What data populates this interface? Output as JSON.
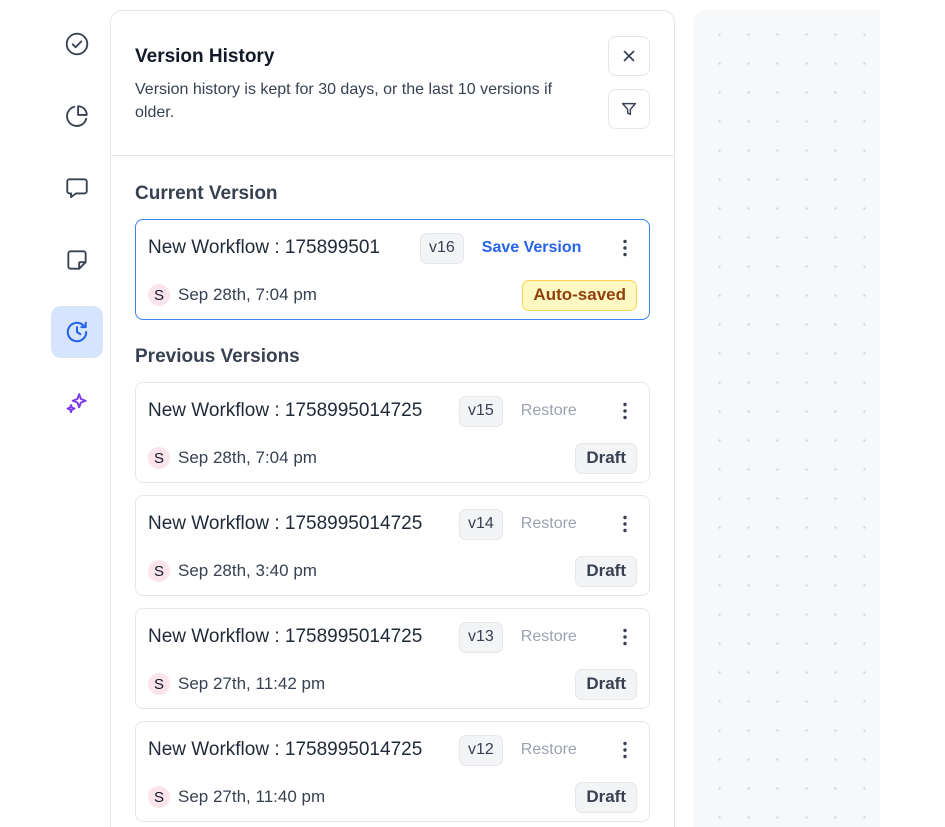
{
  "rail": {
    "items": [
      {
        "icon": "check-circle-icon",
        "active": false
      },
      {
        "icon": "pie-chart-icon",
        "active": false
      },
      {
        "icon": "comment-icon",
        "active": false
      },
      {
        "icon": "sticky-note-icon",
        "active": false
      },
      {
        "icon": "history-icon",
        "active": true
      },
      {
        "icon": "sparkles-icon",
        "active": false
      }
    ],
    "accent": "#3b82f6",
    "ai_color": "#7c3aed"
  },
  "panel": {
    "title": "Version History",
    "description": "Version history is kept for 30 days, or the last 10 versions if older.",
    "close_icon": "close-icon",
    "filter_icon": "filter-icon"
  },
  "current": {
    "heading": "Current Version",
    "card": {
      "name": "New Workflow : 175899501",
      "version": "v16",
      "action": "Save Version",
      "avatar": "S",
      "date": "Sep 28th, 7:04 pm",
      "status": "Auto-saved"
    }
  },
  "previous": {
    "heading": "Previous Versions",
    "cards": [
      {
        "name": "New Workflow : 1758995014725",
        "version": "v15",
        "action": "Restore",
        "avatar": "S",
        "date": "Sep 28th, 7:04 pm",
        "status": "Draft"
      },
      {
        "name": "New Workflow : 1758995014725",
        "version": "v14",
        "action": "Restore",
        "avatar": "S",
        "date": "Sep 28th, 3:40 pm",
        "status": "Draft"
      },
      {
        "name": "New Workflow : 1758995014725",
        "version": "v13",
        "action": "Restore",
        "avatar": "S",
        "date": "Sep 27th, 11:42 pm",
        "status": "Draft"
      },
      {
        "name": "New Workflow : 1758995014725",
        "version": "v12",
        "action": "Restore",
        "avatar": "S",
        "date": "Sep 27th, 11:40 pm",
        "status": "Draft"
      }
    ]
  }
}
